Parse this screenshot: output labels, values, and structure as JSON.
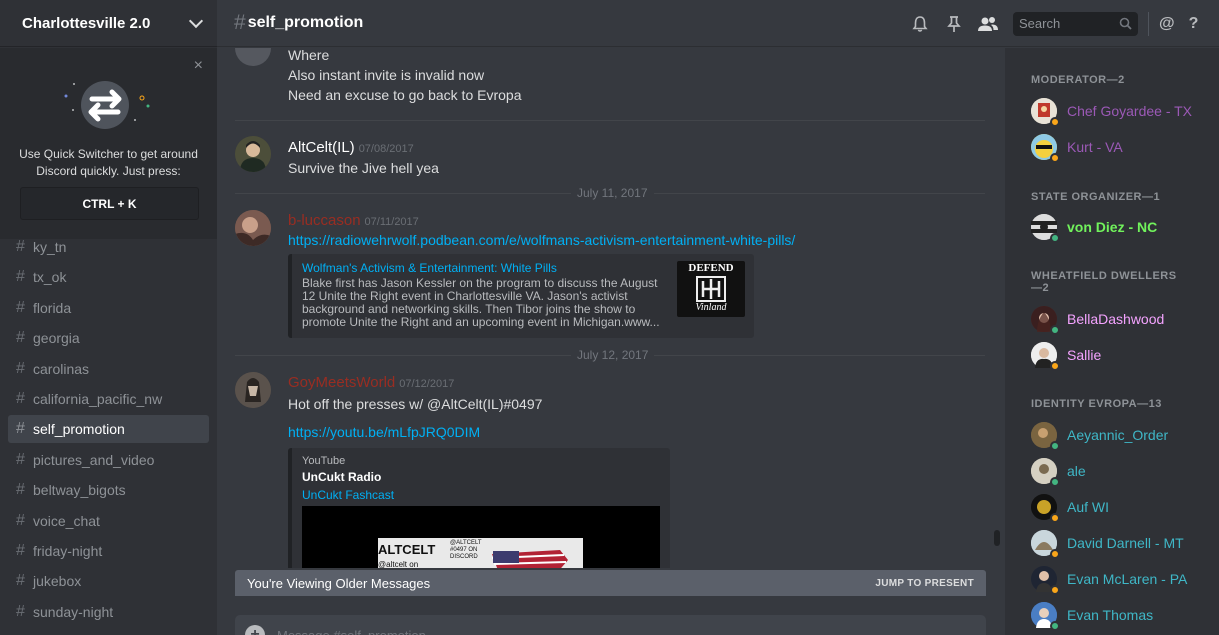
{
  "colors": {
    "moderator": "#9b59b6",
    "organizer": "#71f25c",
    "dweller": "#f4a3ff",
    "identity": "#3fb7c7",
    "online": "#43b581",
    "idle": "#faa61a"
  },
  "guild": {
    "name": "Charlottesville 2.0"
  },
  "quick_switcher": {
    "text": "Use Quick Switcher to get around Discord quickly. Just press:",
    "key": "CTRL + K",
    "close": "×"
  },
  "channels": [
    "ky_tn",
    "tx_ok",
    "florida",
    "georgia",
    "carolinas",
    "california_pacific_nw",
    "self_promotion",
    "pictures_and_video",
    "beltway_bigots",
    "voice_chat",
    "friday-night",
    "jukebox",
    "sunday-night"
  ],
  "topbar": {
    "hash": "#",
    "channel": "self_promotion",
    "search_placeholder": "Search",
    "mention": "@",
    "help": "?"
  },
  "messages": {
    "cont_lines": [
      "Where",
      "Also instant invite is invalid now",
      "Need an excuse to go back to Evropa"
    ],
    "m1": {
      "author": "AltCelt(IL)",
      "time": "07/08/2017",
      "text": "Survive the Jive hell yea"
    },
    "date1": "July 11, 2017",
    "m2": {
      "author": "b-luccason",
      "time": "07/11/2017",
      "link": "https://radiowehrwolf.podbean.com/e/wolfmans-activism-entertainment-white-pills/",
      "embed_title": "Wolfman's Activism & Entertainment: White Pills",
      "embed_desc": "Blake first has Jason Kessler on the program to discuss the August 12 Unite the Right event in Charlottesville VA. Jason's activist background and networking skills. Then Tibor joins the show to promote Unite the Right and an upcoming event in Michigan.www...",
      "thumb_top": "DEFEND",
      "thumb_bottom": "Vinland"
    },
    "date2": "July 12, 2017",
    "m3": {
      "author": "GoyMeetsWorld",
      "time": "07/12/2017",
      "text": "Hot off the presses w/ @AltCelt(IL)#0497",
      "link": "https://youtu.be/mLfpJRQ0DIM",
      "provider": "YouTube",
      "video_title": "UnCukt Radio",
      "channel": "UnCukt Fashcast",
      "thumb_text": "ALTCELT",
      "thumb_handle": "@altcelt on",
      "thumb_handle2": "@ALTCELT #0497 ON DISCORD"
    }
  },
  "older_bar": {
    "text": "You're Viewing Older Messages",
    "jump": "JUMP TO PRESENT"
  },
  "composer": {
    "placeholder": "Message #self_promotion",
    "add": "+"
  },
  "members": {
    "groups": [
      {
        "title": "MODERATOR—2"
      },
      {
        "title": "STATE ORGANIZER—1"
      },
      {
        "title": "WHEATFIELD DWELLERS—2"
      },
      {
        "title": "IDENTITY EVROPA—13"
      }
    ],
    "list": [
      {
        "name": "Chef Goyardee - TX"
      },
      {
        "name": "Kurt - VA"
      },
      {
        "name": "von Diez - NC"
      },
      {
        "name": "BellaDashwood"
      },
      {
        "name": "Sallie"
      },
      {
        "name": "Aeyannic_Order"
      },
      {
        "name": "ale"
      },
      {
        "name": "Auf WI"
      },
      {
        "name": "David Darnell - MT"
      },
      {
        "name": "Evan McLaren - PA"
      },
      {
        "name": "Evan Thomas"
      }
    ]
  }
}
